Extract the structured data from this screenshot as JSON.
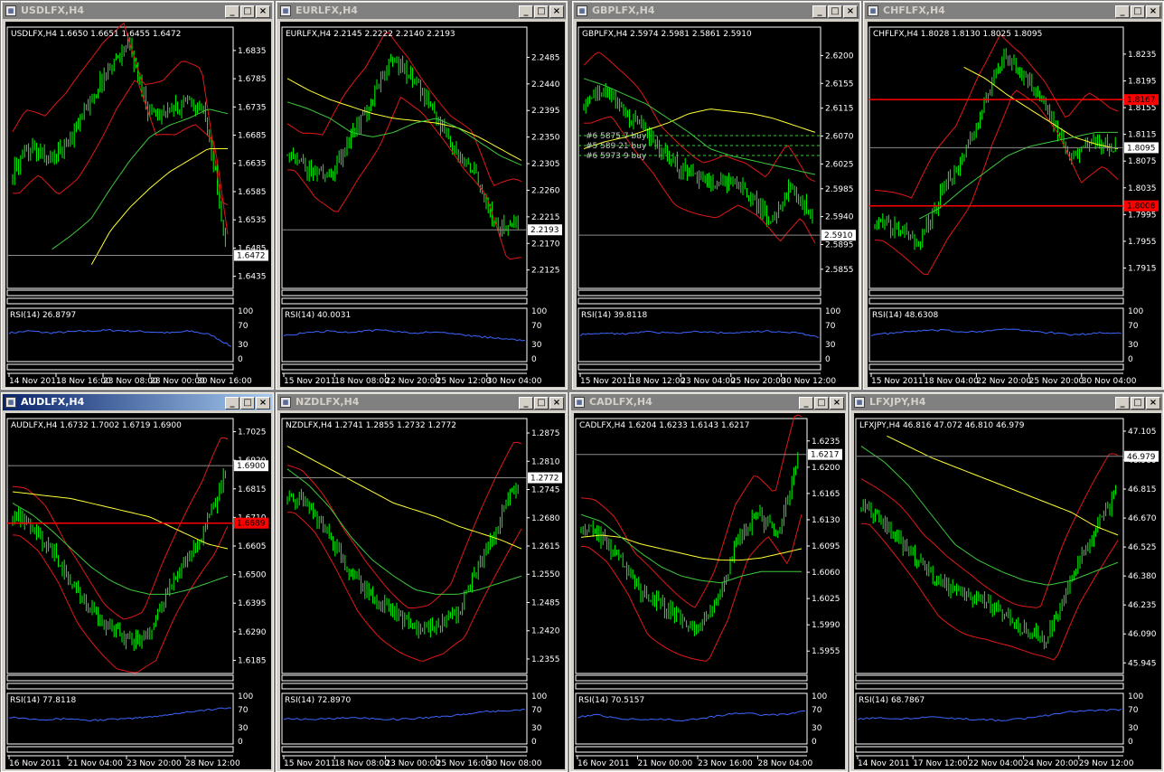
{
  "colors": {
    "candle": "#00ff00",
    "band": "#e01818",
    "ma_yellow": "#ffff33",
    "ma_green": "#3cc83c",
    "rsi": "#3c64ff",
    "axis": "#ffffff",
    "sub_frame": "#ffffff",
    "red_level": "#ff0000"
  },
  "icons": {
    "window_icon": "chart-icon",
    "minimize": "minimize-icon",
    "maximize": "maximize-icon",
    "close": "close-icon"
  },
  "window_buttons": {
    "minimize": "_",
    "maximize": "□",
    "close": "×"
  },
  "windows": [
    {
      "title": "USDLFX,H4",
      "active": false,
      "info": "USDLFX,H4  1.6650 1.6651 1.6455 1.6472",
      "price_ticks": [
        "1.6835",
        "1.6785",
        "1.6735",
        "1.6685",
        "1.6635",
        "1.6585",
        "1.6535",
        "1.6485",
        "1.6435"
      ],
      "price_tag": {
        "label": "1.6472",
        "style": "white"
      },
      "red_tags": [],
      "orders": [],
      "rsi_label": "RSI(14) 26.8797",
      "rsi_ticks": [
        "100",
        "70",
        "30",
        "0"
      ],
      "time_ticks": [
        "14 Nov 2011",
        "18 Nov 16:00",
        "23 Nov 08:00",
        "28 Nov 00:00",
        "30 Nov 16:00"
      ],
      "chart_data": {
        "type": "candlestick",
        "symbol": "USDLFX",
        "timeframe": "H4",
        "last_bar": {
          "open": 1.665,
          "high": 1.6651,
          "low": 1.6455,
          "close": 1.6472
        },
        "y_range": [
          1.642,
          1.687
        ],
        "shape": [
          0.45,
          0.55,
          0.5,
          0.6,
          0.75,
          0.9,
          1.0,
          0.72,
          0.7,
          0.75,
          0.7,
          0.15
        ],
        "yellow_ma": [
          null,
          null,
          null,
          null,
          0.05,
          0.2,
          0.3,
          0.38,
          0.45,
          0.5,
          0.55,
          0.55
        ],
        "green_ma": [
          null,
          null,
          0.12,
          0.18,
          0.25,
          0.38,
          0.5,
          0.6,
          0.65,
          0.68,
          0.72,
          0.7
        ],
        "rsi_last": 26.8797,
        "rsi_shape": [
          0.55,
          0.6,
          0.55,
          0.58,
          0.6,
          0.62,
          0.6,
          0.58,
          0.55,
          0.6,
          0.5,
          0.2
        ]
      }
    },
    {
      "title": "EURLFX,H4",
      "active": false,
      "info": "EURLFX,H4  2.2145 2.2222 2.2140 2.2193",
      "price_ticks": [
        "2.2485",
        "2.2440",
        "2.2395",
        "2.2350",
        "2.2305",
        "2.2260",
        "2.2215",
        "2.2170",
        "2.2125"
      ],
      "price_tag": {
        "label": "2.2193",
        "style": "white"
      },
      "red_tags": [],
      "orders": [],
      "rsi_label": "RSI(14) 40.0031",
      "rsi_ticks": [
        "100",
        "70",
        "30",
        "0"
      ],
      "time_ticks": [
        "15 Nov 2011",
        "18 Nov 08:00",
        "22 Nov 20:00",
        "25 Nov 12:00",
        "30 Nov 04:00"
      ],
      "chart_data": {
        "type": "candlestick",
        "symbol": "EURLFX",
        "timeframe": "H4",
        "last_bar": {
          "open": 2.2145,
          "high": 2.2222,
          "low": 2.214,
          "close": 2.2193
        },
        "y_range": [
          2.21,
          2.253
        ],
        "shape": [
          0.55,
          0.45,
          0.42,
          0.6,
          0.75,
          0.95,
          0.85,
          0.7,
          0.55,
          0.45,
          0.2,
          0.25
        ],
        "yellow_ma": [
          0.85,
          0.8,
          0.76,
          0.73,
          0.7,
          0.68,
          0.67,
          0.66,
          0.64,
          0.6,
          0.55,
          0.5
        ],
        "green_ma": [
          0.75,
          0.72,
          0.68,
          0.62,
          0.6,
          0.62,
          0.66,
          0.68,
          0.64,
          0.58,
          0.52,
          0.48
        ],
        "rsi_last": 40.0031,
        "rsi_shape": [
          0.5,
          0.55,
          0.6,
          0.58,
          0.62,
          0.6,
          0.55,
          0.58,
          0.5,
          0.45,
          0.4,
          0.35
        ]
      }
    },
    {
      "title": "GBPLFX,H4",
      "active": false,
      "info": "GBPLFX,H4  2.5974 2.5981 2.5861 2.5910",
      "price_ticks": [
        "2.6200",
        "2.6155",
        "2.6115",
        "2.6070",
        "2.6025",
        "2.5985",
        "2.5940",
        "2.5895",
        "2.5855"
      ],
      "price_tag": {
        "label": "2.5910",
        "style": "white"
      },
      "red_tags": [],
      "orders": [
        "#6 5875 7 buy",
        "#5 589 21 buy",
        "#6 5973 9 buy"
      ],
      "rsi_label": "RSI(14) 39.8118",
      "rsi_ticks": [
        "100",
        "70",
        "30",
        "0"
      ],
      "time_ticks": [
        "15 Nov 2011",
        "18 Nov 12:00",
        "23 Nov 04:00",
        "25 Nov 20:00",
        "30 Nov 12:00"
      ],
      "chart_data": {
        "type": "candlestick",
        "symbol": "GBPLFX",
        "timeframe": "H4",
        "last_bar": {
          "open": 2.5974,
          "high": 2.5981,
          "low": 2.5861,
          "close": 2.591
        },
        "y_range": [
          2.583,
          2.624
        ],
        "shape": [
          0.75,
          0.8,
          0.7,
          0.62,
          0.5,
          0.45,
          0.4,
          0.42,
          0.35,
          0.25,
          0.38,
          0.25
        ],
        "yellow_ma": [
          0.55,
          0.58,
          0.6,
          0.63,
          0.66,
          0.7,
          0.72,
          0.71,
          0.7,
          0.68,
          0.65,
          0.62
        ],
        "green_ma": [
          0.85,
          0.82,
          0.78,
          0.74,
          0.68,
          0.62,
          0.55,
          0.52,
          0.5,
          0.48,
          0.46,
          0.44
        ],
        "rsi_last": 39.8118,
        "rsi_shape": [
          0.5,
          0.55,
          0.52,
          0.6,
          0.55,
          0.58,
          0.56,
          0.55,
          0.6,
          0.58,
          0.55,
          0.45
        ]
      }
    },
    {
      "title": "CHFLFX,H4",
      "active": false,
      "info": "CHFLFX,H4  1.8028 1.8130 1.8025 1.8095",
      "price_ticks": [
        "1.8235",
        "1.8195",
        "1.8155",
        "1.8115",
        "1.8075",
        "1.8035",
        "1.7995",
        "1.7955",
        "1.7915"
      ],
      "price_tag": {
        "label": "1.8095",
        "style": "white"
      },
      "red_tags": [
        {
          "label": "1.8167",
          "value": 1.8167
        },
        {
          "label": "1.8008",
          "value": 1.8008
        }
      ],
      "orders": [],
      "rsi_label": "RSI(14) 48.6308",
      "rsi_ticks": [
        "100",
        "70",
        "30",
        "0"
      ],
      "time_ticks": [
        "15 Nov 2011",
        "18 Nov 04:00",
        "22 Nov 20:00",
        "25 Nov 20:00",
        "30 Nov 04:00"
      ],
      "chart_data": {
        "type": "candlestick",
        "symbol": "CHFLFX",
        "timeframe": "H4",
        "last_bar": {
          "open": 1.8028,
          "high": 1.813,
          "low": 1.8025,
          "close": 1.8095
        },
        "y_range": [
          1.789,
          1.827
        ],
        "shape": [
          0.25,
          0.2,
          0.15,
          0.35,
          0.5,
          0.75,
          0.95,
          0.85,
          0.7,
          0.5,
          0.6,
          0.55
        ],
        "yellow_ma": [
          null,
          null,
          null,
          null,
          0.9,
          0.85,
          0.78,
          0.72,
          0.66,
          0.6,
          0.57,
          0.55
        ],
        "green_ma": [
          null,
          null,
          0.25,
          0.3,
          0.38,
          0.45,
          0.52,
          0.56,
          0.58,
          0.6,
          0.62,
          0.62
        ],
        "rsi_last": 48.6308,
        "rsi_shape": [
          0.5,
          0.55,
          0.6,
          0.62,
          0.58,
          0.6,
          0.65,
          0.6,
          0.55,
          0.5,
          0.55,
          0.55
        ]
      }
    },
    {
      "title": "AUDLFX,H4",
      "active": true,
      "info": "AUDLFX,H4  1.6732 1.7002 1.6719 1.6900",
      "price_ticks": [
        "1.7025",
        "1.6920",
        "1.6815",
        "1.6710",
        "1.6605",
        "1.6500",
        "1.6395",
        "1.6290",
        "1.6185"
      ],
      "price_tag": {
        "label": "1.6900",
        "style": "white"
      },
      "red_tags": [
        {
          "label": "1.6689",
          "value": 1.6689
        }
      ],
      "orders": [],
      "rsi_label": "RSI(14) 77.8118",
      "rsi_ticks": [
        "100",
        "70",
        "30",
        "0"
      ],
      "time_ticks": [
        "16 Nov 2011",
        "21 Nov 04:00",
        "23 Nov 20:00",
        "28 Nov 12:00"
      ],
      "chart_data": {
        "type": "candlestick",
        "symbol": "AUDLFX",
        "timeframe": "H4",
        "last_bar": {
          "open": 1.6732,
          "high": 1.7002,
          "low": 1.6719,
          "close": 1.69
        },
        "y_range": [
          1.615,
          1.706
        ],
        "shape": [
          0.65,
          0.6,
          0.5,
          0.35,
          0.25,
          0.15,
          0.1,
          0.12,
          0.3,
          0.45,
          0.6,
          0.82
        ],
        "yellow_ma": [
          0.75,
          0.74,
          0.73,
          0.72,
          0.7,
          0.68,
          0.66,
          0.64,
          0.6,
          0.56,
          0.52,
          0.5
        ],
        "green_ma": [
          0.7,
          0.65,
          0.58,
          0.5,
          0.42,
          0.36,
          0.32,
          0.3,
          0.3,
          0.32,
          0.35,
          0.38
        ],
        "rsi_last": 77.8118,
        "rsi_shape": [
          0.55,
          0.5,
          0.48,
          0.5,
          0.45,
          0.48,
          0.5,
          0.55,
          0.62,
          0.7,
          0.75,
          0.8
        ]
      }
    },
    {
      "title": "NZDLFX,H4",
      "active": false,
      "info": "NZDLFX,H4  1.2741 1.2855 1.2732 1.2772",
      "price_ticks": [
        "1.2875",
        "1.2810",
        "1.2745",
        "1.2680",
        "1.2615",
        "1.2550",
        "1.2485",
        "1.2420",
        "1.2355"
      ],
      "price_tag": {
        "label": "1.2772",
        "style": "white"
      },
      "red_tags": [],
      "orders": [],
      "rsi_label": "RSI(14) 72.8970",
      "rsi_ticks": [
        "100",
        "70",
        "30",
        "0"
      ],
      "time_ticks": [
        "15 Nov 2011",
        "18 Nov 08:00",
        "23 Nov 00:00",
        "25 Nov 16:00",
        "30 Nov 08:00"
      ],
      "chart_data": {
        "type": "candlestick",
        "symbol": "NZDLFX",
        "timeframe": "H4",
        "last_bar": {
          "open": 1.2741,
          "high": 1.2855,
          "low": 1.2732,
          "close": 1.2772
        },
        "y_range": [
          1.233,
          1.29
        ],
        "shape": [
          0.75,
          0.68,
          0.55,
          0.4,
          0.3,
          0.22,
          0.15,
          0.15,
          0.2,
          0.4,
          0.6,
          0.8
        ],
        "yellow_ma": [
          0.95,
          0.9,
          0.85,
          0.8,
          0.75,
          0.7,
          0.67,
          0.64,
          0.6,
          0.57,
          0.54,
          0.5
        ],
        "green_ma": [
          0.85,
          0.78,
          0.68,
          0.55,
          0.45,
          0.38,
          0.32,
          0.3,
          0.3,
          0.32,
          0.35,
          0.38
        ],
        "rsi_last": 72.897,
        "rsi_shape": [
          0.5,
          0.48,
          0.5,
          0.52,
          0.5,
          0.48,
          0.5,
          0.55,
          0.6,
          0.68,
          0.72,
          0.75
        ]
      }
    },
    {
      "title": "CADLFX,H4",
      "active": false,
      "info": "CADLFX,H4  1.6204 1.6233 1.6143 1.6217",
      "price_ticks": [
        "1.6235",
        "1.6200",
        "1.6165",
        "1.6130",
        "1.6095",
        "1.6060",
        "1.6025",
        "1.5990",
        "1.5955"
      ],
      "price_tag": {
        "label": "1.6217",
        "style": "white"
      },
      "red_tags": [],
      "orders": [],
      "rsi_label": "RSI(14) 70.5157",
      "rsi_ticks": [
        "100",
        "70",
        "30",
        "0"
      ],
      "time_ticks": [
        "16 Nov 2011",
        "21 Nov 00:00",
        "23 Nov 16:00",
        "28 Nov 04:00"
      ],
      "chart_data": {
        "type": "candlestick",
        "symbol": "CADLFX",
        "timeframe": "H4",
        "last_bar": {
          "open": 1.6204,
          "high": 1.6233,
          "low": 1.6143,
          "close": 1.6217
        },
        "y_range": [
          1.593,
          1.626
        ],
        "shape": [
          0.6,
          0.55,
          0.45,
          0.3,
          0.25,
          0.2,
          0.15,
          0.3,
          0.55,
          0.65,
          0.55,
          0.92
        ],
        "yellow_ma": [
          0.55,
          0.56,
          0.55,
          0.52,
          0.5,
          0.48,
          0.46,
          0.45,
          0.45,
          0.46,
          0.48,
          0.5
        ],
        "green_ma": [
          0.65,
          0.62,
          0.55,
          0.48,
          0.42,
          0.38,
          0.36,
          0.35,
          0.38,
          0.4,
          0.4,
          0.4
        ],
        "rsi_last": 70.5157,
        "rsi_shape": [
          0.55,
          0.6,
          0.5,
          0.48,
          0.5,
          0.45,
          0.5,
          0.6,
          0.65,
          0.6,
          0.62,
          0.7
        ]
      }
    },
    {
      "title": "LFXJPY,H4",
      "active": false,
      "info": "LFXJPY,H4  46.816 47.072 46.810 46.979",
      "price_ticks": [
        "47.105",
        "46.960",
        "46.815",
        "46.670",
        "46.525",
        "46.380",
        "46.235",
        "46.090",
        "45.945"
      ],
      "price_tag": {
        "label": "46.979",
        "style": "white"
      },
      "red_tags": [],
      "orders": [],
      "rsi_label": "RSI(14) 68.7867",
      "rsi_ticks": [
        "100",
        "70",
        "30",
        "0"
      ],
      "time_ticks": [
        "14 Nov 2011",
        "17 Nov 12:00",
        "22 Nov 04:00",
        "24 Nov 20:00",
        "29 Nov 12:00"
      ],
      "chart_data": {
        "type": "candlestick",
        "symbol": "LFXJPY",
        "timeframe": "H4",
        "last_bar": {
          "open": 46.816,
          "high": 47.072,
          "low": 46.81,
          "close": 46.979
        },
        "y_range": [
          45.91,
          47.15
        ],
        "shape": [
          0.7,
          0.6,
          0.5,
          0.38,
          0.32,
          0.28,
          0.22,
          0.15,
          0.1,
          0.35,
          0.55,
          0.75
        ],
        "yellow_ma": [
          null,
          1.0,
          0.95,
          0.9,
          0.86,
          0.82,
          0.78,
          0.74,
          0.7,
          0.66,
          0.6,
          0.56
        ],
        "green_ma": [
          0.95,
          0.88,
          0.78,
          0.65,
          0.52,
          0.45,
          0.4,
          0.36,
          0.34,
          0.36,
          0.4,
          0.44
        ],
        "rsi_last": 68.7867,
        "rsi_shape": [
          0.5,
          0.52,
          0.5,
          0.55,
          0.5,
          0.48,
          0.45,
          0.5,
          0.6,
          0.7,
          0.72,
          0.75
        ]
      }
    }
  ]
}
